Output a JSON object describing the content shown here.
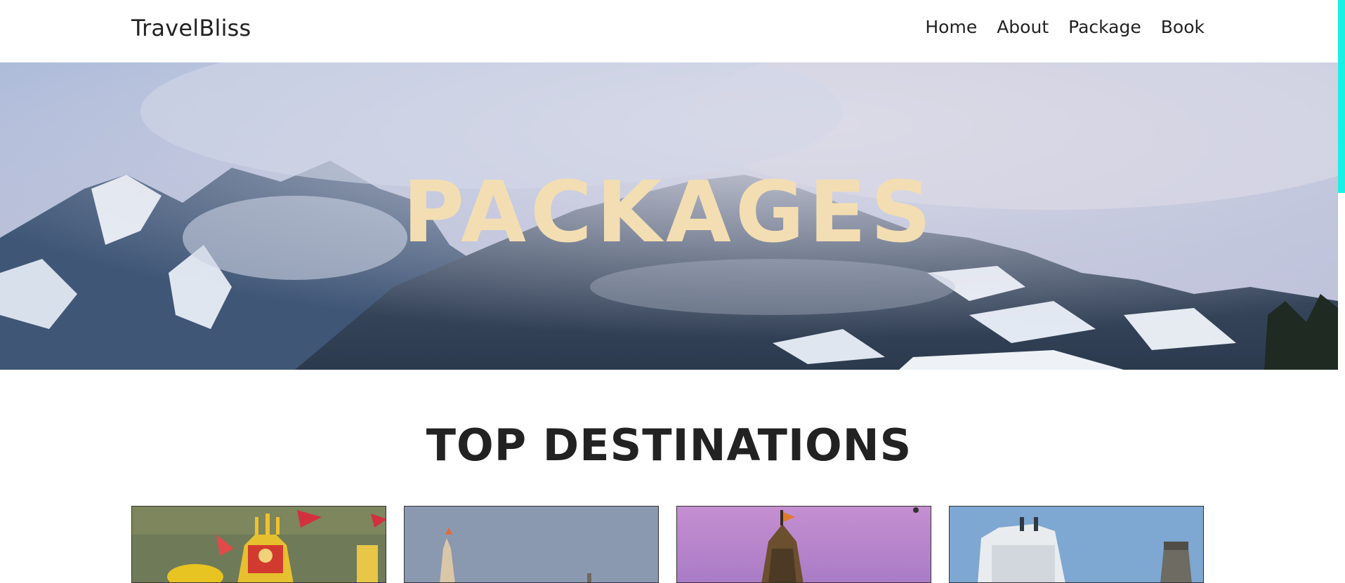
{
  "header": {
    "brand": "TravelBliss",
    "nav": [
      "Home",
      "About",
      "Package",
      "Book"
    ]
  },
  "hero": {
    "title": "PACKAGES"
  },
  "section": {
    "title": "TOP DESTINATIONS"
  },
  "colors": {
    "hero_title": "#f3deb3",
    "scroll_accent": "#19f1e6",
    "text": "#222222"
  },
  "icons": {
    "cards": [
      "temple-photo",
      "temple-photo",
      "temple-photo",
      "temple-photo"
    ]
  }
}
